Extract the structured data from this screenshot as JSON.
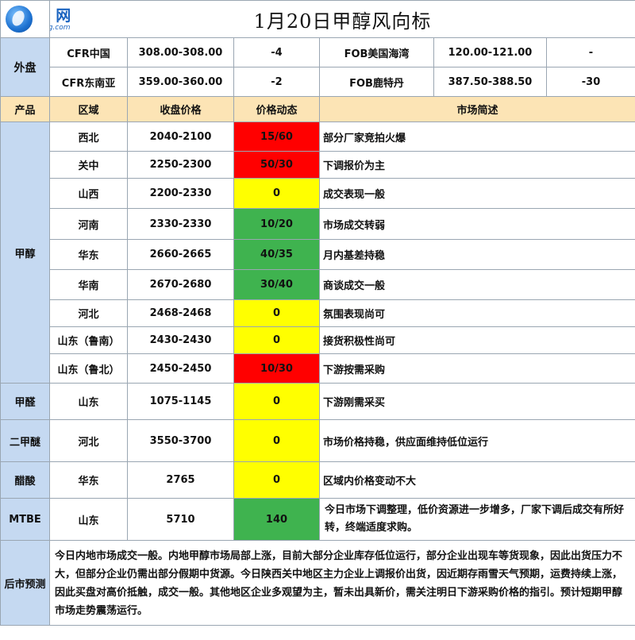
{
  "header": {
    "logo_cn": "甲 醇 网",
    "logo_en": "JiaChunWang.com",
    "title": "1月20日甲醇风向标"
  },
  "external": {
    "label": "外盘",
    "rows": [
      {
        "left_name": "CFR中国",
        "left_price": "308.00-308.00",
        "left_change": "-4",
        "right_name": "FOB美国海湾",
        "right_price": "120.00-121.00",
        "right_change": "-"
      },
      {
        "left_name": "CFR东南亚",
        "left_price": "359.00-360.00",
        "left_change": "-2",
        "right_name": "FOB鹿特丹",
        "right_price": "387.50-388.50",
        "right_change": "-30"
      }
    ]
  },
  "columns": {
    "product": "产品",
    "region": "区域",
    "price": "收盘价格",
    "dynamic": "价格动态",
    "summary": "市场简述"
  },
  "products": [
    {
      "name": "甲醇",
      "rows": [
        {
          "region": "西北",
          "price": "2040-2100",
          "dynamic": "15/60",
          "color": "#ff0000",
          "summary": "部分厂家竞拍火爆"
        },
        {
          "region": "关中",
          "price": "2250-2300",
          "dynamic": "50/30",
          "color": "#ff0000",
          "summary": "下调报价为主"
        },
        {
          "region": "山西",
          "price": "2200-2330",
          "dynamic": "0",
          "color": "#ffff00",
          "summary": "成交表现一般"
        },
        {
          "region": "河南",
          "price": "2330-2330",
          "dynamic": "10/20",
          "color": "#3fb34f",
          "summary": "市场成交转弱"
        },
        {
          "region": "华东",
          "price": "2660-2665",
          "dynamic": "40/35",
          "color": "#3fb34f",
          "summary": "月内基差持稳"
        },
        {
          "region": "华南",
          "price": "2670-2680",
          "dynamic": "30/40",
          "color": "#3fb34f",
          "summary": "商谈成交一般"
        },
        {
          "region": "河北",
          "price": "2468-2468",
          "dynamic": "0",
          "color": "#ffff00",
          "summary": "氛围表现尚可"
        },
        {
          "region": "山东（鲁南）",
          "price": "2430-2430",
          "dynamic": "0",
          "color": "#ffff00",
          "summary": "接货积极性尚可"
        },
        {
          "region": "山东（鲁北）",
          "price": "2450-2450",
          "dynamic": "10/30",
          "color": "#ff0000",
          "summary": "下游按需采购"
        }
      ]
    },
    {
      "name": "甲醛",
      "rows": [
        {
          "region": "山东",
          "price": "1075-1145",
          "dynamic": "0",
          "color": "#ffff00",
          "summary": "下游刚需采买"
        }
      ]
    },
    {
      "name": "二甲醚",
      "rows": [
        {
          "region": "河北",
          "price": "3550-3700",
          "dynamic": "0",
          "color": "#ffff00",
          "summary": "市场价格持稳，供应面维持低位运行"
        }
      ]
    },
    {
      "name": "醋酸",
      "rows": [
        {
          "region": "华东",
          "price": "2765",
          "dynamic": "0",
          "color": "#ffff00",
          "summary": "区域内价格变动不大"
        }
      ]
    },
    {
      "name": "MTBE",
      "rows": [
        {
          "region": "山东",
          "price": "5710",
          "dynamic": "140",
          "color": "#3fb34f",
          "summary": "今日市场下调整理，低价资源进一步增多，厂家下调后成交有所好转，终端适度求购。"
        }
      ]
    }
  ],
  "forecast": {
    "label": "后市预测",
    "text": "今日内地市场成交一般。内地甲醇市场局部上涨，目前大部分企业库存低位运行，部分企业出现车等货现象，因此出货压力不大，但部分企业仍需出部分假期中货源。今日陕西关中地区主力企业上调报价出货，因近期存雨雪天气预期，运费持续上涨，因此买盘对高价抵触，成交一般。其他地区企业多观望为主，暂未出具新价，需关注明日下游采购价格的指引。预计短期甲醇市场走势震荡运行。"
  }
}
